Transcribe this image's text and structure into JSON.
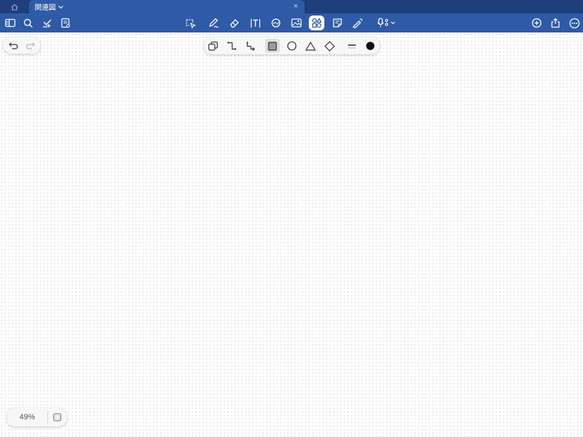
{
  "tabbar": {
    "home_icon": "home-icon",
    "tab_title": "関連図",
    "close_glyph": "×"
  },
  "toolbar": {
    "left_icons": [
      "sidebar-icon",
      "search-icon",
      "bookmark-add-icon",
      "page-list-icon"
    ],
    "center_icons": [
      "lasso-icon",
      "pen-icon",
      "eraser-icon",
      "text-box-icon",
      "shape-recognition-icon",
      "image-icon",
      "shapes-icon",
      "sticky-note-icon",
      "laser-pointer-icon",
      "microphone-icon"
    ],
    "active_tool": "shapes-icon",
    "right_icons": [
      "add-icon",
      "share-icon",
      "more-icon"
    ]
  },
  "shape_toolbar": {
    "items": [
      "shape-stack-icon",
      "elbow-connector-icon",
      "elbow-arrow-icon",
      "square-icon",
      "circle-icon",
      "triangle-icon",
      "diamond-icon",
      "line-weight-icon",
      "color-dot-icon"
    ],
    "selected": "square-icon",
    "color": "#111111"
  },
  "zoom": {
    "label": "49%"
  },
  "colors": {
    "tabbar_bg": "#1f3f7a",
    "toolbar_bg": "#2f5aa6",
    "canvas_dot": "#e2e2e2"
  }
}
